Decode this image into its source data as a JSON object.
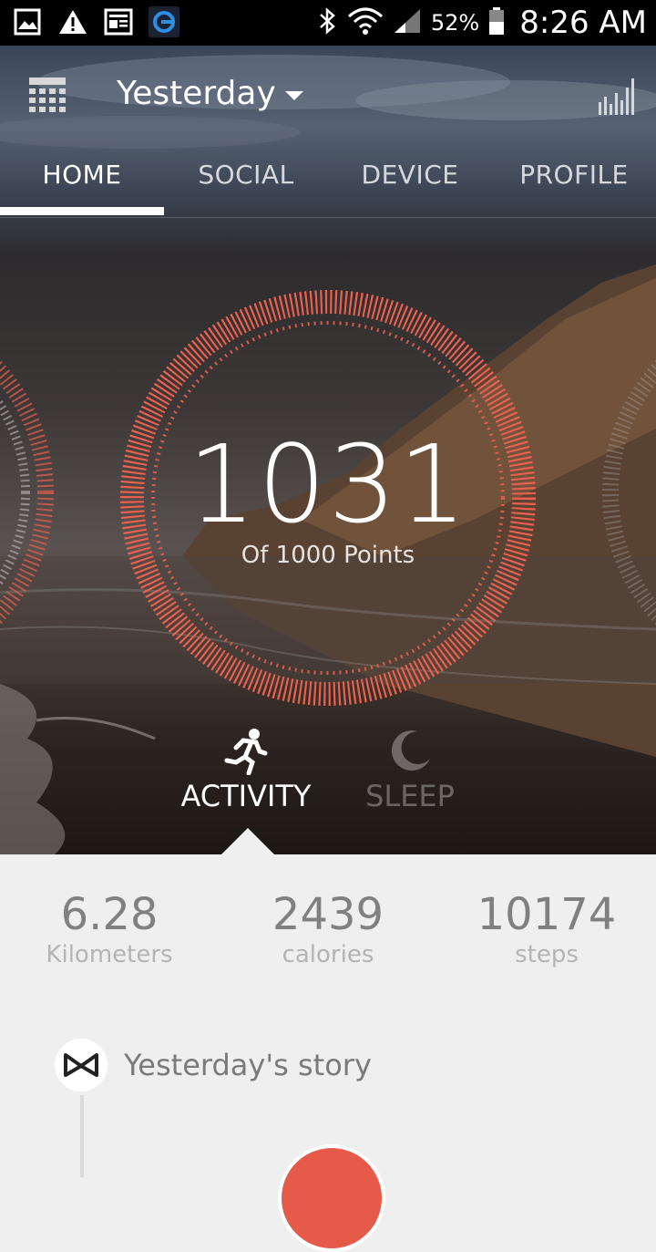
{
  "status_bar": {
    "icons": [
      "gallery-icon",
      "warning-icon",
      "news-icon",
      "app-icon",
      "bluetooth-icon",
      "wifi-icon",
      "signal-icon",
      "battery-icon"
    ],
    "battery": "52%",
    "time": "8:26 AM"
  },
  "header": {
    "date_label": "Yesterday"
  },
  "tabs": [
    {
      "label": "HOME"
    },
    {
      "label": "SOCIAL"
    },
    {
      "label": "DEVICE"
    },
    {
      "label": "PROFILE"
    }
  ],
  "score": {
    "value": "1031",
    "subtitle": "Of 1000 Points",
    "progress_fraction": 1.0
  },
  "modes": {
    "activity": "ACTIVITY",
    "sleep": "SLEEP"
  },
  "metrics": [
    {
      "value": "6.28",
      "unit": "Kilometers"
    },
    {
      "value": "2439",
      "unit": "calories"
    },
    {
      "value": "10174",
      "unit": "steps"
    }
  ],
  "story": {
    "title": "Yesterday's story"
  },
  "colors": {
    "accent": "#e8604e",
    "panel": "#efefef"
  }
}
